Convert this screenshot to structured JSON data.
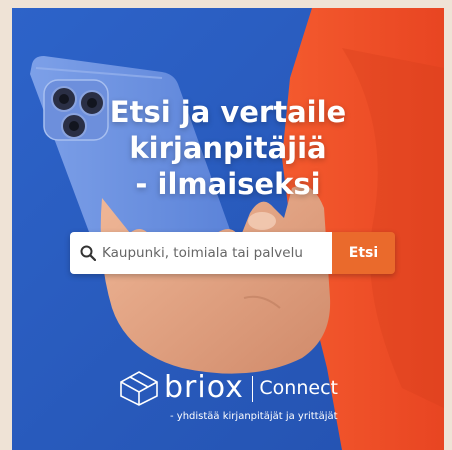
{
  "headline": {
    "line1": "Etsi ja vertaile",
    "line2": "kirjanpitäjiä",
    "line3": "- ilmaiseksi"
  },
  "search": {
    "placeholder": "Kaupunki, toimiala tai palvelu",
    "button_label": "Etsi"
  },
  "logo": {
    "brand": "briox",
    "product": "Connect",
    "tagline": "- yhdistää kirjanpitäjät ja yrittäjät"
  },
  "colors": {
    "background_blue": "#2b5ec0",
    "sleeve_orange": "#f0512a",
    "accent_orange": "#ea6a2c",
    "page_beige": "#efe3d6"
  },
  "icons": {
    "search": "search-icon",
    "logo": "briox-cube-logo-icon"
  }
}
